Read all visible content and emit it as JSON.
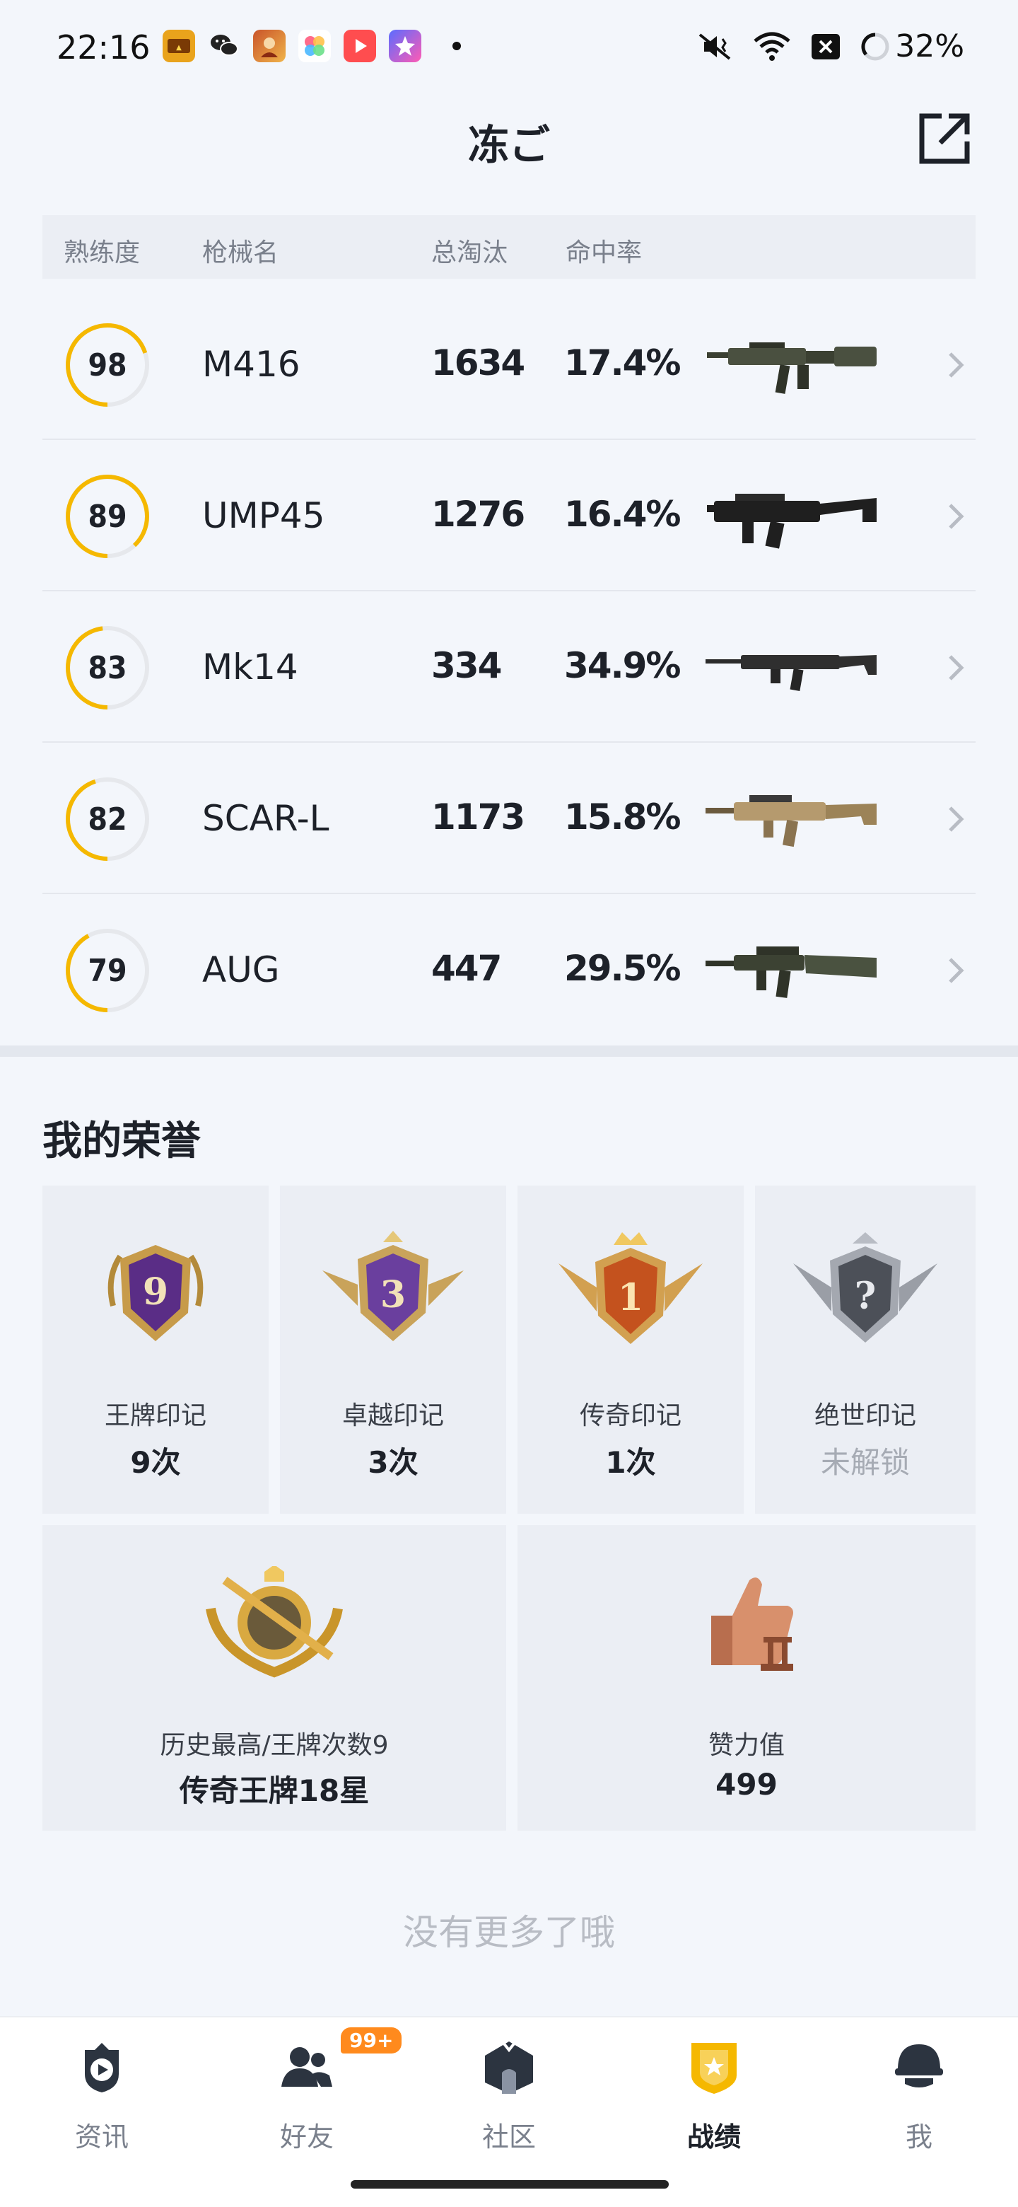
{
  "status_bar": {
    "time": "22:16",
    "battery": "32%",
    "app_icons": [
      "game-app-icon",
      "wechat-icon",
      "hero-game-icon",
      "photos-app-icon",
      "video-app-icon",
      "star-app-icon"
    ],
    "system_icons": [
      "mute-vibrate-icon",
      "wifi-icon",
      "close-box-icon",
      "battery-ring-icon"
    ]
  },
  "header": {
    "title": "冻ご",
    "share_icon": "share-external-icon"
  },
  "weapon_table": {
    "headers": {
      "proficiency": "熟练度",
      "name": "枪械名",
      "kills": "总淘汰",
      "hit_rate": "命中率"
    },
    "rows": [
      {
        "proficiency": "98",
        "proficiency_fraction": 0.7,
        "name": "M416",
        "kills": "1634",
        "hit_rate": "17.4%",
        "weapon_icon": "m416-rifle-icon"
      },
      {
        "proficiency": "89",
        "proficiency_fraction": 0.88,
        "name": "UMP45",
        "kills": "1276",
        "hit_rate": "16.4%",
        "weapon_icon": "ump45-smg-icon"
      },
      {
        "proficiency": "83",
        "proficiency_fraction": 0.48,
        "name": "Mk14",
        "kills": "334",
        "hit_rate": "34.9%",
        "weapon_icon": "mk14-rifle-icon"
      },
      {
        "proficiency": "82",
        "proficiency_fraction": 0.45,
        "name": "SCAR-L",
        "kills": "1173",
        "hit_rate": "15.8%",
        "weapon_icon": "scar-l-rifle-icon"
      },
      {
        "proficiency": "79",
        "proficiency_fraction": 0.42,
        "name": "AUG",
        "kills": "447",
        "hit_rate": "29.5%",
        "weapon_icon": "aug-rifle-icon"
      }
    ]
  },
  "honors": {
    "title": "我的荣誉",
    "marks": [
      {
        "label": "王牌印记",
        "value": "9次",
        "badge_text": "9",
        "badge_icon": "ace-mark-badge-icon",
        "locked": false
      },
      {
        "label": "卓越印记",
        "value": "3次",
        "badge_text": "3",
        "badge_icon": "excellence-mark-badge-icon",
        "locked": false
      },
      {
        "label": "传奇印记",
        "value": "1次",
        "badge_text": "1",
        "badge_icon": "legend-mark-badge-icon",
        "locked": false
      },
      {
        "label": "绝世印记",
        "value": "未解锁",
        "badge_text": "?",
        "badge_icon": "peerless-mark-badge-icon",
        "locked": true
      }
    ],
    "history": {
      "label": "历史最高/王牌次数9",
      "value": "传奇王牌18星",
      "badge_icon": "legend-ace-rank-badge-icon"
    },
    "likes": {
      "label": "赞力值",
      "value": "499",
      "badge_icon": "thumbs-up-trophy-icon"
    }
  },
  "footer_note": "没有更多了哦",
  "bottom_nav": {
    "items": [
      {
        "label": "资讯",
        "icon": "news-play-icon",
        "active": false
      },
      {
        "label": "好友",
        "icon": "friends-icon",
        "badge": "99+",
        "active": false
      },
      {
        "label": "社区",
        "icon": "community-house-icon",
        "active": false
      },
      {
        "label": "战绩",
        "icon": "record-shield-icon",
        "active": true
      },
      {
        "label": "我",
        "icon": "helmet-profile-icon",
        "active": false
      }
    ]
  },
  "colors": {
    "accent": "#f5b800",
    "ring_track": "#e6e8ec",
    "badge_orange": "#ff8a1d",
    "background": "#f3f6fb"
  }
}
